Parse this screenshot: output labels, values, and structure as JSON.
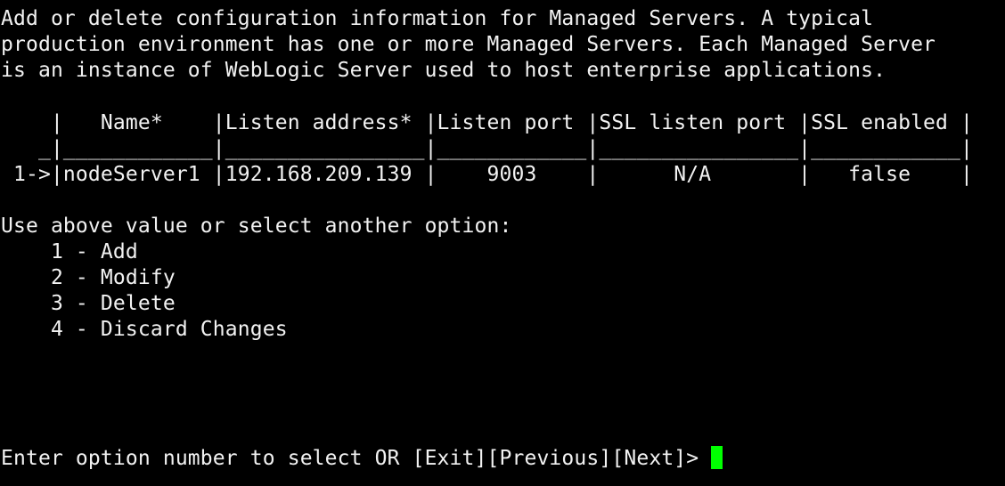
{
  "terminal": {
    "description_lines": [
      "Add or delete configuration information for Managed Servers. A typical",
      "production environment has one or more Managed Servers. Each Managed Server",
      "is an instance of WebLogic Server used to host enterprise applications."
    ],
    "table": {
      "header_line": "    |   Name*    |Listen address* |Listen port |SSL listen port |SSL enabled |",
      "separator_line": "   _|____________|________________|____________|________________|____________|",
      "rows": [
        " 1->|nodeServer1 |192.168.209.139 |    9003    |      N/A       |   false    |"
      ]
    },
    "prompt_header": "Use above value or select another option:",
    "options": [
      "    1 - Add",
      "    2 - Modify",
      "    3 - Delete",
      "    4 - Discard Changes"
    ],
    "input_prompt": "Enter option number to select OR [Exit][Previous][Next]> ",
    "colors": {
      "background": "#000000",
      "text": "#f2f2f2",
      "cursor": "#00ff00"
    }
  }
}
